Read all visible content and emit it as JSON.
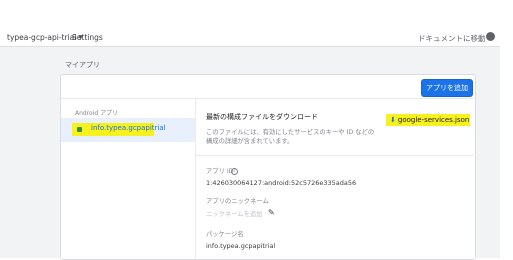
{
  "topbar": {
    "project": "typea-gcp-api-trial",
    "settings": "Settings",
    "docs": "ドキュメントに移動"
  },
  "page": {
    "section_title": "マイアプリ",
    "add_app_button": "アプリを追加"
  },
  "sidebar": {
    "platform_label": "Android アプリ",
    "selected_app": "info.typea.gcpapitrial"
  },
  "config": {
    "heading": "最新の構成ファイルをダウンロード",
    "description": "このファイルには、有効にしたサービスのキーや ID などの構成の詳細が含まれています。",
    "download_label": "google-services.json"
  },
  "fields": {
    "app_id_label": "アプリ ID",
    "app_id_value": "1:426030064127:android:52c5726e335ada56",
    "nickname_label": "アプリのニックネーム",
    "nickname_placeholder": "ニックネームを追加",
    "package_label": "パッケージ名",
    "package_value": "info.typea.gcpapitrial"
  },
  "icons": {
    "caret": "arrow-drop-down-icon",
    "help": "help-circle-icon",
    "edit": "pencil-icon",
    "download": "download-icon",
    "android": "android-icon"
  },
  "colors": {
    "primary": "#1a73e8",
    "highlight": "#f7f11e"
  }
}
